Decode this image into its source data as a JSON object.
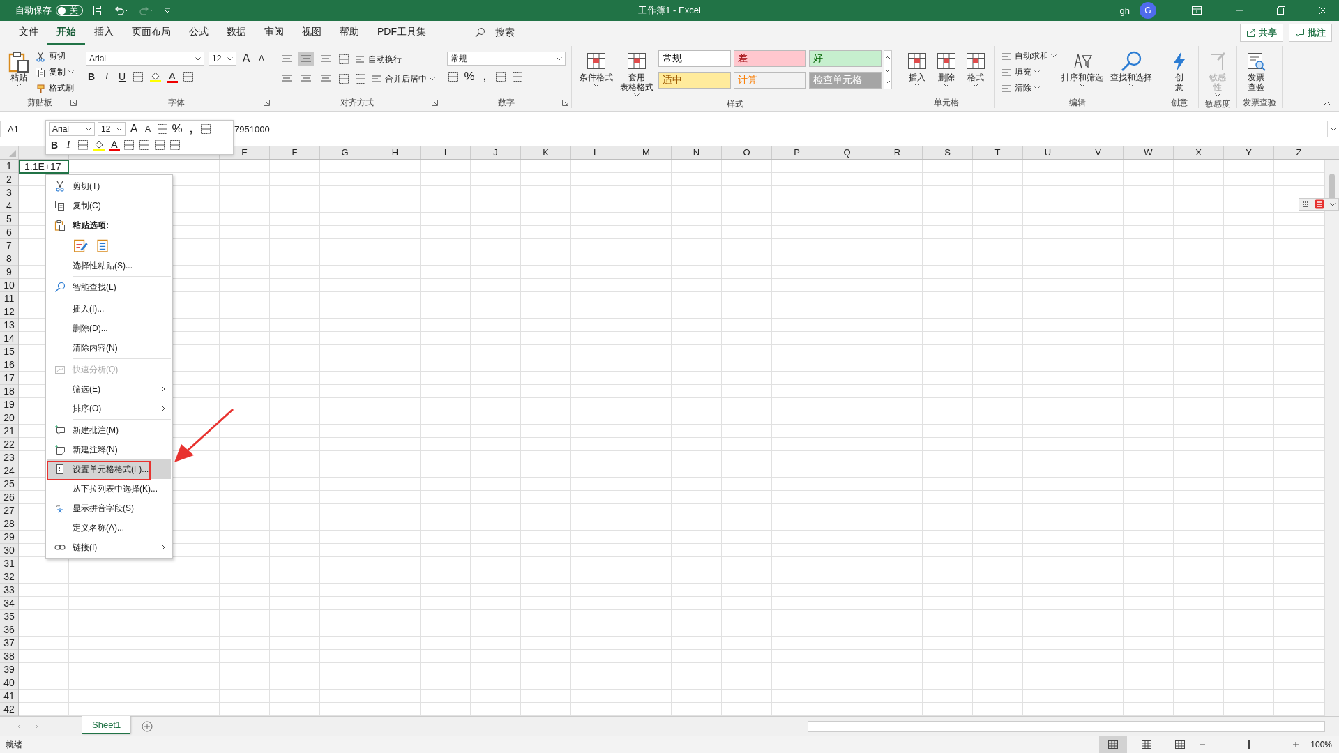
{
  "title_bar": {
    "autosave_label": "自动保存",
    "autosave_toggle": {
      "on": false,
      "label": "关"
    },
    "title": "工作簿1  -  Excel",
    "user": "gh",
    "avatar": "G"
  },
  "tabs": [
    {
      "label": "文件",
      "selected": false
    },
    {
      "label": "开始",
      "selected": true
    },
    {
      "label": "插入",
      "selected": false
    },
    {
      "label": "页面布局",
      "selected": false
    },
    {
      "label": "公式",
      "selected": false
    },
    {
      "label": "数据",
      "selected": false
    },
    {
      "label": "审阅",
      "selected": false
    },
    {
      "label": "视图",
      "selected": false
    },
    {
      "label": "帮助",
      "selected": false
    },
    {
      "label": "PDF工具集",
      "selected": false
    }
  ],
  "search": {
    "placeholder": "搜索"
  },
  "share_button": "共享",
  "comments_button": "批注",
  "ribbon": [
    {
      "label": "剪贴板",
      "launcher": true,
      "columns": [
        [
          {
            "kind": "large",
            "lines": [
              "粘贴"
            ],
            "dropdown": true,
            "disabled": false
          }
        ],
        [
          {
            "kind": "small",
            "label": "剪切",
            "dropdown": false
          },
          {
            "kind": "small",
            "label": "复制",
            "dropdown": true
          },
          {
            "kind": "small",
            "label": "格式刷",
            "dropdown": false
          }
        ]
      ]
    },
    {
      "label": "字体",
      "launcher": true,
      "rows": [
        [
          {
            "kind": "font-combo",
            "value": "Arial"
          },
          {
            "kind": "size-combo",
            "value": "12"
          },
          {
            "kind": "font-grow",
            "label": "A"
          },
          {
            "kind": "font-shrink",
            "label": "A"
          }
        ],
        [
          {
            "kind": "bold",
            "label": "B"
          },
          {
            "kind": "italic",
            "label": "I"
          },
          {
            "kind": "underline",
            "label": "U"
          },
          {
            "kind": "icon"
          },
          {
            "kind": "fill"
          },
          {
            "kind": "fontcolor",
            "label": "A"
          },
          {
            "kind": "icon"
          }
        ]
      ]
    },
    {
      "label": "对齐方式",
      "launcher": true,
      "rows": [
        [
          {
            "kind": "align",
            "selected": false
          },
          {
            "kind": "align",
            "selected": true
          },
          {
            "kind": "align",
            "selected": false
          },
          {
            "kind": "icon"
          },
          {
            "kind": "small",
            "label": "自动换行",
            "dropdown": false
          }
        ],
        [
          {
            "kind": "align",
            "selected": false
          },
          {
            "kind": "align",
            "selected": false
          },
          {
            "kind": "align",
            "selected": false
          },
          {
            "kind": "icon"
          },
          {
            "kind": "icon"
          },
          {
            "kind": "small",
            "label": "合并后居中",
            "dropdown": true
          }
        ]
      ]
    },
    {
      "label": "数字",
      "launcher": true,
      "rows": [
        [
          {
            "kind": "format-combo",
            "value": "常规"
          }
        ],
        [
          {
            "kind": "icon"
          },
          {
            "kind": "symbol",
            "label": "%"
          },
          {
            "kind": "bold",
            "label": ","
          },
          {
            "kind": "icon"
          },
          {
            "kind": "icon"
          }
        ]
      ]
    },
    {
      "label": "样式",
      "launcher": false,
      "columns": [
        [
          {
            "kind": "large",
            "lines": [
              "条件格式"
            ],
            "dropdown": true,
            "disabled": false
          }
        ],
        [
          {
            "kind": "large",
            "lines": [
              "套用",
              "表格格式"
            ],
            "dropdown": true,
            "disabled": false
          }
        ],
        [
          {
            "kind": "gallery",
            "cells": [
              {
                "label": "常规",
                "color": "#ffffff"
              },
              {
                "label": "差",
                "color": "#ffc7ce"
              },
              {
                "label": "好",
                "color": "#c6efce"
              },
              {
                "label": "适中",
                "color": "#ffeb9c"
              },
              {
                "label": "计算",
                "color": "#f2f2f2"
              },
              {
                "label": "检查单元格",
                "color": "#a5a5a5"
              }
            ]
          }
        ]
      ]
    },
    {
      "label": "单元格",
      "launcher": false,
      "columns": [
        [
          {
            "kind": "large",
            "lines": [
              "插入"
            ],
            "dropdown": true,
            "disabled": false
          }
        ],
        [
          {
            "kind": "large",
            "lines": [
              "删除"
            ],
            "dropdown": true,
            "disabled": false
          }
        ],
        [
          {
            "kind": "large",
            "lines": [
              "格式"
            ],
            "dropdown": true,
            "disabled": false
          }
        ]
      ]
    },
    {
      "label": "编辑",
      "launcher": false,
      "columns": [
        [
          {
            "kind": "small",
            "label": "自动求和",
            "dropdown": true
          },
          {
            "kind": "small",
            "label": "填充",
            "dropdown": true
          },
          {
            "kind": "small",
            "label": "清除",
            "dropdown": true
          }
        ],
        [
          {
            "kind": "large",
            "lines": [
              "排序和筛选"
            ],
            "dropdown": true,
            "disabled": false
          }
        ],
        [
          {
            "kind": "large",
            "lines": [
              "查找和选择"
            ],
            "dropdown": true,
            "disabled": false
          }
        ]
      ]
    },
    {
      "label": "创意",
      "launcher": false,
      "columns": [
        [
          {
            "kind": "large",
            "lines": [
              "创",
              "意"
            ],
            "dropdown": false,
            "disabled": false
          }
        ]
      ]
    },
    {
      "label": "敏感度",
      "launcher": false,
      "columns": [
        [
          {
            "kind": "large",
            "lines": [
              "敏感",
              "性"
            ],
            "dropdown": true,
            "disabled": true
          }
        ]
      ]
    },
    {
      "label": "发票查验",
      "launcher": false,
      "columns": [
        [
          {
            "kind": "large",
            "lines": [
              "发票",
              "查验"
            ],
            "dropdown": false,
            "disabled": false
          }
        ]
      ]
    }
  ],
  "name_box": "A1",
  "formula": "7951000",
  "mini_toolbar": {
    "rows": [
      [
        {
          "kind": "font-combo",
          "value": "Arial"
        },
        {
          "kind": "size-combo",
          "value": "12"
        },
        {
          "kind": "font-grow",
          "label": "A"
        },
        {
          "kind": "font-shrink",
          "label": "A"
        },
        {
          "kind": "icon"
        },
        {
          "kind": "symbol",
          "label": "%"
        },
        {
          "kind": "bold",
          "label": ","
        },
        {
          "kind": "icon"
        }
      ],
      [
        {
          "kind": "bold",
          "label": "B"
        },
        {
          "kind": "italic",
          "label": "I"
        },
        {
          "kind": "icon"
        },
        {
          "kind": "fill"
        },
        {
          "kind": "fontcolor",
          "label": "A"
        },
        {
          "kind": "icon"
        },
        {
          "kind": "icon"
        },
        {
          "kind": "icon"
        },
        {
          "kind": "icon"
        }
      ]
    ]
  },
  "columns": [
    "E",
    "F",
    "G",
    "H",
    "I",
    "J",
    "K",
    "L",
    "M",
    "N",
    "O",
    "P",
    "Q",
    "R",
    "S",
    "T",
    "U",
    "V",
    "W",
    "X",
    "Y",
    "Z"
  ],
  "rows": [
    "1",
    "2",
    "3",
    "4",
    "5",
    "6",
    "7",
    "8",
    "9",
    "10",
    "11",
    "12",
    "13",
    "14",
    "15",
    "16",
    "17",
    "18",
    "19",
    "20",
    "21",
    "22",
    "23",
    "24",
    "25",
    "26",
    "27",
    "28",
    "29",
    "30",
    "31",
    "32",
    "33",
    "34",
    "35",
    "36",
    "37",
    "38",
    "39",
    "40",
    "41",
    "42"
  ],
  "active_cell": {
    "value": "1.1E+17"
  },
  "context_menu": [
    {
      "kind": "item",
      "label": "剪切(T)",
      "disabled": false,
      "submenu": false,
      "selected": false
    },
    {
      "kind": "item",
      "label": "复制(C)",
      "disabled": false,
      "submenu": false,
      "selected": false
    },
    {
      "kind": "header",
      "label": "粘贴选项:"
    },
    {
      "kind": "paste-options"
    },
    {
      "kind": "item",
      "label": "选择性粘贴(S)...",
      "disabled": false,
      "submenu": false,
      "selected": false
    },
    {
      "kind": "separator"
    },
    {
      "kind": "item",
      "label": "智能查找(L)",
      "disabled": false,
      "submenu": false,
      "selected": false
    },
    {
      "kind": "separator"
    },
    {
      "kind": "item",
      "label": "插入(I)...",
      "disabled": false,
      "submenu": false,
      "selected": false
    },
    {
      "kind": "item",
      "label": "删除(D)...",
      "disabled": false,
      "submenu": false,
      "selected": false
    },
    {
      "kind": "item",
      "label": "清除内容(N)",
      "disabled": false,
      "submenu": false,
      "selected": false
    },
    {
      "kind": "separator"
    },
    {
      "kind": "item",
      "label": "快速分析(Q)",
      "disabled": true,
      "submenu": false,
      "selected": false
    },
    {
      "kind": "item",
      "label": "筛选(E)",
      "disabled": false,
      "submenu": true,
      "selected": false
    },
    {
      "kind": "item",
      "label": "排序(O)",
      "disabled": false,
      "submenu": true,
      "selected": false
    },
    {
      "kind": "separator"
    },
    {
      "kind": "item",
      "label": "新建批注(M)",
      "disabled": false,
      "submenu": false,
      "selected": false
    },
    {
      "kind": "item",
      "label": "新建注释(N)",
      "disabled": false,
      "submenu": false,
      "selected": false
    },
    {
      "kind": "item",
      "label": "设置单元格格式(F)...",
      "disabled": false,
      "submenu": false,
      "selected": true
    },
    {
      "kind": "item",
      "label": "从下拉列表中选择(K)...",
      "disabled": false,
      "submenu": false,
      "selected": false
    },
    {
      "kind": "item",
      "label": "显示拼音字段(S)",
      "disabled": false,
      "submenu": false,
      "selected": false
    },
    {
      "kind": "item",
      "label": "定义名称(A)...",
      "disabled": false,
      "submenu": false,
      "selected": false
    },
    {
      "kind": "item",
      "label": "链接(I)",
      "disabled": false,
      "submenu": true,
      "selected": false
    }
  ],
  "sheet_tabs": [
    {
      "label": "Sheet1",
      "selected": true
    }
  ],
  "status_bar": {
    "status": "就绪",
    "views": [
      {
        "selected": true
      },
      {
        "selected": false
      },
      {
        "selected": false
      }
    ],
    "zoom_slider": {
      "level": 0.5
    },
    "zoom": "100%"
  }
}
